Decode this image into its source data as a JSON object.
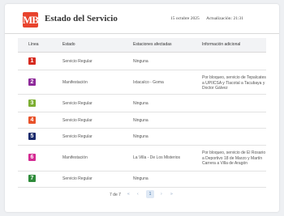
{
  "header": {
    "logo_text": "MB",
    "title": "Estado del Servicio",
    "date": "15 octubre 2025",
    "update": "Actualización: 21:31"
  },
  "table": {
    "columns": [
      "Línea",
      "Estado",
      "Estaciones afectadas",
      "Información adicional"
    ],
    "rows": [
      {
        "line": "1",
        "color": "#d62a1f",
        "status": "Servicio Regular",
        "stations": "Ninguna",
        "info": ""
      },
      {
        "line": "2",
        "color": "#8e2a9a",
        "status": "Manifestación",
        "stations": "Ixtacalco - Goma",
        "info": "Por bloqueo, servicio de Tepalcates a UPIICSA y Tlacotal a Tacubaya y Doctor Gálvez"
      },
      {
        "line": "3",
        "color": "#7cae32",
        "status": "Servicio Regular",
        "stations": "Ninguna",
        "info": ""
      },
      {
        "line": "4",
        "color": "#e8522a",
        "status": "Servicio Regular",
        "stations": "Ninguna",
        "info": ""
      },
      {
        "line": "5",
        "color": "#1a2a6c",
        "status": "Servicio Regular",
        "stations": "Ninguna",
        "info": ""
      },
      {
        "line": "6",
        "color": "#d42a92",
        "status": "Manifestación",
        "stations": "La Villa - De Los Misterios",
        "info": "Por bloqueo, servicio de El Rosario a Deportivo 18 de Marzo y Martín Carrera a Villa de Aragón"
      },
      {
        "line": "7",
        "color": "#2e8b3a",
        "status": "Servicio Regular",
        "stations": "Ninguna",
        "info": ""
      }
    ]
  },
  "pagination": {
    "text": "7 de 7",
    "first": "«",
    "prev": "‹",
    "current": "1",
    "next": "›",
    "last": "»"
  }
}
